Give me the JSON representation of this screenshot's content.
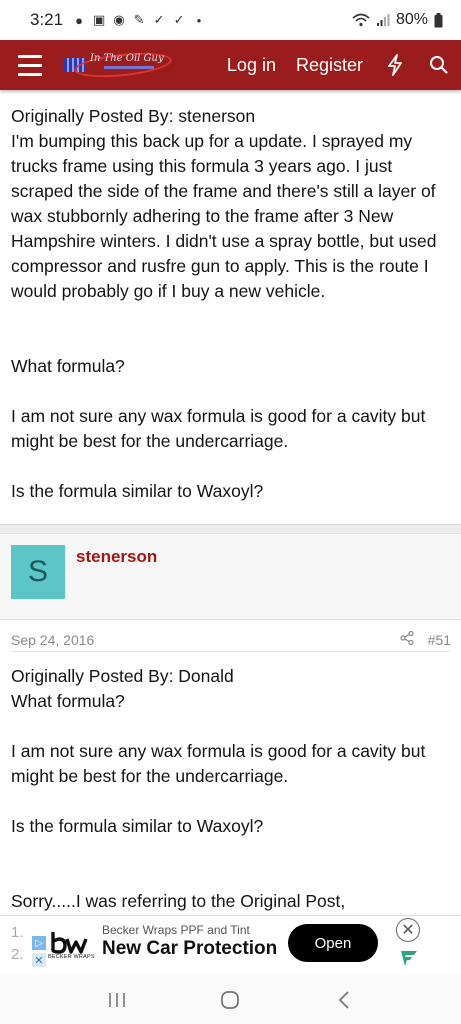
{
  "status": {
    "time": "3:21",
    "battery": "80%"
  },
  "nav": {
    "login": "Log in",
    "register": "Register",
    "logo_text": "In The Oil Guy"
  },
  "post1": {
    "quote_header": "Originally Posted By: stenerson",
    "quote_text": "I'm bumping this back up for a update. I sprayed my trucks frame using this formula 3 years ago. I just scraped the side of the frame and there's still a layer of wax stubbornly adhering to the frame after 3 New Hampshire winters. I didn't use a spray bottle, but used compressor and rusfre gun to apply. This is the route I would probably go if I buy a new vehicle.",
    "reply_1": "What formula?",
    "reply_2": "I am not sure any wax formula is good for a cavity but might be best for the undercarriage.",
    "reply_3": "Is the formula similar to Waxoyl?"
  },
  "member": {
    "avatar_letter": "S",
    "username": "stenerson"
  },
  "post2_meta": {
    "date": "Sep 24, 2016",
    "post_number": "#51"
  },
  "post2": {
    "quote_header": "Originally Posted By: Donald",
    "line_1": "What formula?",
    "line_2": "I am not sure any wax formula is good for a cavity but might be best for the undercarriage.",
    "line_3": "Is the formula similar to Waxoyl?",
    "line_4": "Sorry.....I was referring to the Original Post,"
  },
  "ad": {
    "list_nums": [
      "1.",
      "2."
    ],
    "advertiser": "Becker Wraps PPF and Tint",
    "headline": "New Car Protection",
    "cta": "Open",
    "logo_sub": "BECKER WRAPS"
  },
  "colors": {
    "brand_red": "#9b1c1c",
    "username_red": "#a21616",
    "avatar_teal": "#5cc5c5"
  }
}
